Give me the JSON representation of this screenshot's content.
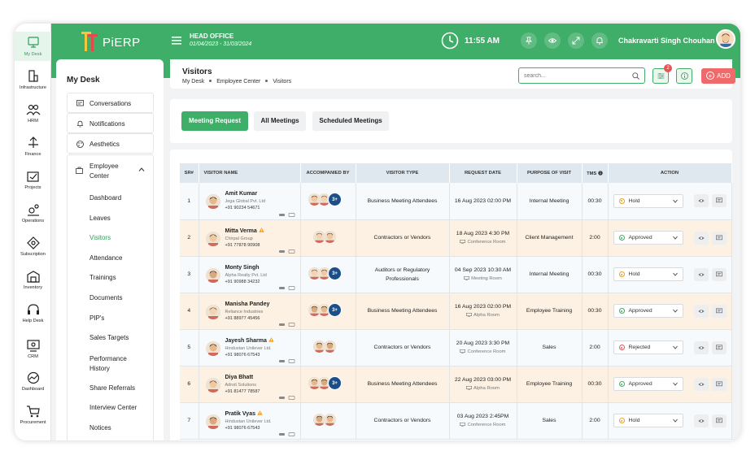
{
  "app": {
    "logo_text": "PiERP",
    "office_name": "HEAD OFFICE",
    "office_dates": "01/04/2023 - 31/03/2024",
    "time": "11:55 AM",
    "user_name": "Chakravarti Singh Chouhan"
  },
  "rail": [
    {
      "label": "My Desk",
      "icon": "desk-icon"
    },
    {
      "label": "Infrastructure",
      "icon": "infrastructure-icon"
    },
    {
      "label": "HRM",
      "icon": "hrm-icon"
    },
    {
      "label": "Finance",
      "icon": "finance-icon"
    },
    {
      "label": "Projects",
      "icon": "projects-icon"
    },
    {
      "label": "Operations",
      "icon": "operations-icon"
    },
    {
      "label": "Subscription",
      "icon": "subscription-icon"
    },
    {
      "label": "Inventory",
      "icon": "inventory-icon"
    },
    {
      "label": "Help Desk",
      "icon": "help-desk-icon"
    },
    {
      "label": "CRM",
      "icon": "crm-icon"
    },
    {
      "label": "Dashboard",
      "icon": "dashboard-icon"
    },
    {
      "label": "Procurement",
      "icon": "procurement-icon"
    }
  ],
  "sidebar": {
    "title": "My Desk",
    "items": [
      {
        "label": "Conversations"
      },
      {
        "label": "Notifications"
      },
      {
        "label": "Aesthetics"
      },
      {
        "label": "Employee Center"
      }
    ],
    "subitems": [
      "Dashboard",
      "Leaves",
      "Visitors",
      "Attendance",
      "Trainings",
      "Documents",
      "PIP's",
      "Sales Targets",
      "Performance History",
      "Share Referrals",
      "Interview Center",
      "Notices"
    ]
  },
  "page": {
    "title": "Visitors",
    "breadcrumb": [
      "My Desk",
      "Employee Center",
      "Visitors"
    ],
    "search_placeholder": "search...",
    "filter_badge": "2",
    "add_label": "ADD",
    "tabs": [
      "Meeting Request",
      "All Meetings",
      "Scheduled Meetings"
    ]
  },
  "table": {
    "headers": [
      "SR#",
      "VISITOR NAME",
      "ACCOMPANIED BY",
      "VISITOR TYPE",
      "REQUEST DATE",
      "PURPOSE OF VISIT",
      "TMS",
      "ACTION"
    ],
    "more_label": "3+",
    "rows": [
      {
        "sr": "1",
        "name": "Amit Kumar",
        "company": "Jega Global Pvt. Ltd",
        "phone": "+91 90234 54671",
        "warn": false,
        "more": true,
        "type": "Business Meeting Attendees",
        "date": "16 Aug 2023 02:00 PM",
        "room": "",
        "purpose": "Internal Meeting",
        "tms": "00:30",
        "status": "Hold"
      },
      {
        "sr": "2",
        "name": "Mitta Verma",
        "company": "Chirpal Group",
        "phone": "+91 77878 90908",
        "warn": true,
        "more": false,
        "type": "Contractors or Vendors",
        "date": "18 Aug 2023 4:30 PM",
        "room": "Conference Room",
        "purpose": "Client Management",
        "tms": "2:00",
        "status": "Approved"
      },
      {
        "sr": "3",
        "name": "Monty Singh",
        "company": "Alpha Realty Pvt. Ltd",
        "phone": "+91 90988 34232",
        "warn": false,
        "more": true,
        "type": "Auditors or Regulatory Professionals",
        "date": "04 Sep 2023 10:30 AM",
        "room": "Meeting Room",
        "purpose": "Internal Meeting",
        "tms": "00:30",
        "status": "Hold"
      },
      {
        "sr": "4",
        "name": "Manisha Pandey",
        "company": "Reliance Industries",
        "phone": "+91 88977 45456",
        "warn": false,
        "more": true,
        "type": "Business Meeting Attendees",
        "date": "16 Aug 2023 02:00 PM",
        "room": "Alpha Room",
        "purpose": "Employee Training",
        "tms": "00:30",
        "status": "Approved"
      },
      {
        "sr": "5",
        "name": "Jayesh Sharma",
        "company": "Hindustan Unilever Ltd.",
        "phone": "+91 98076 67543",
        "warn": true,
        "more": false,
        "type": "Contractors or Vendors",
        "date": "20 Aug 2023 3:30 PM",
        "room": "Conference Room",
        "purpose": "Sales",
        "tms": "2:00",
        "status": "Rejected"
      },
      {
        "sr": "6",
        "name": "Diya Bhatt",
        "company": "Adroit Solutions",
        "phone": "+91 81477 78587",
        "warn": false,
        "more": true,
        "type": "Business Meeting Attendees",
        "date": "22 Aug 2023 03:00 PM",
        "room": "Alpha Room",
        "purpose": "Employee Training",
        "tms": "00:30",
        "status": "Approved"
      },
      {
        "sr": "7",
        "name": "Pratik Vyas",
        "company": "Hindustan Unilever Ltd.",
        "phone": "+91 98076 67543",
        "warn": true,
        "more": false,
        "type": "Contractors or Vendors",
        "date": "03 Aug 2023 2:45PM",
        "room": "Conference Room",
        "purpose": "Sales",
        "tms": "2:00",
        "status": "Hold"
      }
    ]
  },
  "colors": {
    "brand_green": "#3fae68",
    "hold": "#f0a020",
    "approved": "#3fae68",
    "rejected": "#e85454",
    "add_button": "#ef6b6b"
  }
}
